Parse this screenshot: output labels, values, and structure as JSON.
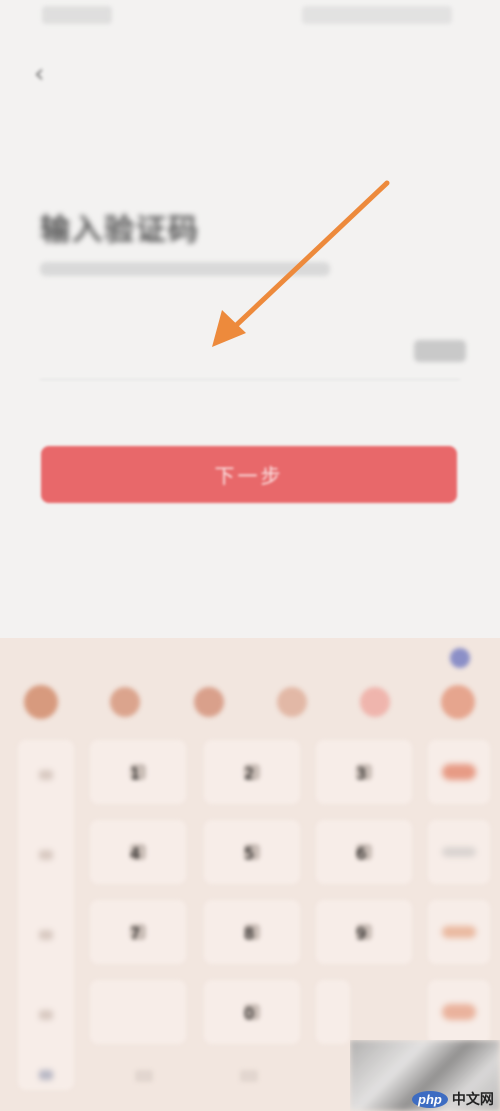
{
  "status_bar": {
    "time": "",
    "icons": ""
  },
  "header": {
    "back_icon": "back-arrow-icon"
  },
  "page": {
    "title": "输入验证码",
    "subtitle": "",
    "code_placeholder": "",
    "resend_label": ""
  },
  "actions": {
    "next_label": "下一步"
  },
  "annotation": {
    "arrow_color": "#ed8a3c"
  },
  "keyboard": {
    "toolbar_icons": [
      "emoji-icon",
      "keyboard-icon",
      "crown-icon",
      "mic-icon",
      "clipboard-icon",
      "settings-icon"
    ],
    "keys": [
      "1",
      "2",
      "3",
      "4",
      "5",
      "6",
      "7",
      "8",
      "9",
      "0"
    ]
  },
  "watermark": {
    "logo_php": "php",
    "logo_text": "中文网"
  },
  "colors": {
    "background": "#f3f2f1",
    "primary_button": "#e8686a",
    "keyboard_bg": "#f2e6df",
    "key_bg": "#f7ede8"
  }
}
